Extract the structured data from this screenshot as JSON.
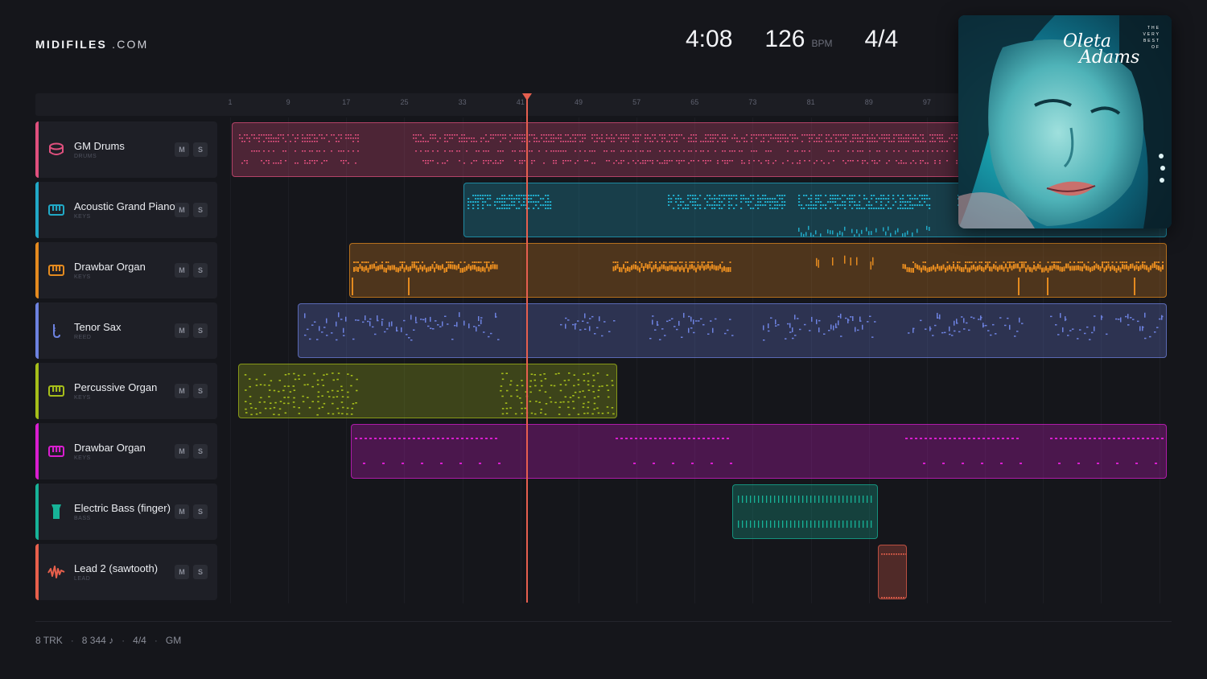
{
  "brand": {
    "name": "MIDIFILES",
    "suffix": ".COM"
  },
  "transport": {
    "time": "4:08",
    "bpm": "126",
    "bpm_unit": "BPM",
    "time_signature": "4/4"
  },
  "ruler": {
    "bars": [
      "1",
      "9",
      "17",
      "25",
      "33",
      "41",
      "49",
      "57",
      "65",
      "73",
      "81",
      "89",
      "97"
    ]
  },
  "tracks": [
    {
      "name": "GM Drums",
      "category": "DRUMS",
      "color": "#e0507e",
      "icon": "drum-icon",
      "mute": "M",
      "solo": "S"
    },
    {
      "name": "Acoustic Grand Piano",
      "category": "KEYS",
      "color": "#21a9c7",
      "icon": "piano-icon",
      "mute": "M",
      "solo": "S"
    },
    {
      "name": "Drawbar Organ",
      "category": "KEYS",
      "color": "#e48a1f",
      "icon": "organ-icon",
      "mute": "M",
      "solo": "S"
    },
    {
      "name": "Tenor Sax",
      "category": "REED",
      "color": "#6d82e0",
      "icon": "saxophone-icon",
      "mute": "M",
      "solo": "S"
    },
    {
      "name": "Percussive Organ",
      "category": "KEYS",
      "color": "#a6be1a",
      "icon": "organ-icon",
      "mute": "M",
      "solo": "S"
    },
    {
      "name": "Drawbar Organ",
      "category": "KEYS",
      "color": "#d91ed0",
      "icon": "organ-icon",
      "mute": "M",
      "solo": "S"
    },
    {
      "name": "Electric Bass (finger)",
      "category": "BASS",
      "color": "#17b398",
      "icon": "bass-icon",
      "mute": "M",
      "solo": "S"
    },
    {
      "name": "Lead 2 (sawtooth)",
      "category": "LEAD",
      "color": "#e8604c",
      "icon": "waveform-icon",
      "mute": "M",
      "solo": "S"
    }
  ],
  "album": {
    "title_line1": "Oleta",
    "title_line2": "Adams",
    "subtitle": "THE VERY BEST OF"
  },
  "footer": {
    "tracks": "8 TRK",
    "notes": "8 344 ♪",
    "time_signature": "4/4",
    "standard": "GM",
    "separator": "·"
  }
}
